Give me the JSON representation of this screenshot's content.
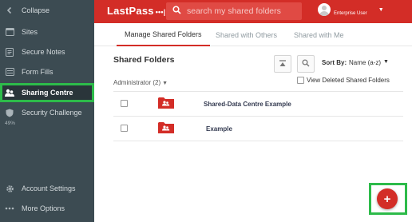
{
  "sidebar": {
    "items": [
      {
        "label": "Collapse",
        "icon": "chevron-left-icon"
      },
      {
        "label": "Sites",
        "icon": "sites-icon"
      },
      {
        "label": "Secure Notes",
        "icon": "note-icon"
      },
      {
        "label": "Form Fills",
        "icon": "form-icon"
      },
      {
        "label": "Sharing Centre",
        "icon": "sharing-icon"
      },
      {
        "label": "Security Challenge",
        "icon": "shield-icon"
      },
      {
        "label": "Account Settings",
        "icon": "gear-icon"
      },
      {
        "label": "More Options",
        "icon": "more-icon"
      }
    ],
    "security_score": "49%",
    "active_item": "Sharing Centre"
  },
  "header": {
    "logo": "LastPass",
    "logo_dots": "•••|",
    "search_placeholder": "search my shared folders",
    "user_name": "Enterprise User"
  },
  "tabs": [
    {
      "label": "Manage Shared Folders",
      "active": true
    },
    {
      "label": "Shared with Others",
      "active": false
    },
    {
      "label": "Shared with Me",
      "active": false
    }
  ],
  "main": {
    "title": "Shared Folders",
    "sort_label": "Sort By:",
    "sort_value": "Name (a-z)",
    "admin_group": "Administrator (2)",
    "view_deleted_label": "View Deleted Shared Folders",
    "folders": [
      {
        "name": "Shared-Data Centre Example"
      },
      {
        "name": "Example"
      }
    ]
  },
  "fab": {
    "label": "+"
  },
  "colors": {
    "brand_red": "#d32d27",
    "sidebar_bg": "#3c4b52",
    "highlight_green": "#2dbb4a"
  }
}
